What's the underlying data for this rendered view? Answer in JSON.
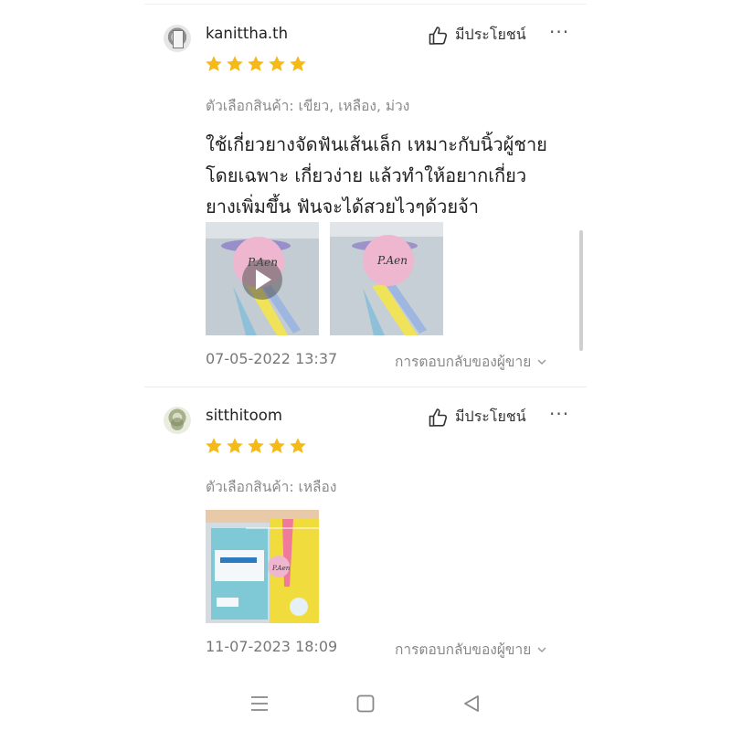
{
  "reviews": [
    {
      "username": "kanittha.th",
      "helpful_label": "มีประโยชน์",
      "stars": 5,
      "variant": "ตัวเลือกสินค้า: เขียว, เหลือง, ม่วง",
      "text_lines": [
        "ใช้เกี่ยวยางจัดฟันเส้นเล็ก เหมาะกับนิ้วผู้ชาย",
        "โดยเฉพาะ  เกี่ยวง่าย แล้วทำให้อยากเกี่ยว",
        "ยางเพิ่มขึ้น ฟันจะได้สวยไวๆด้วยจ้า"
      ],
      "media": [
        {
          "kind": "video",
          "card_text": "P.Aen"
        },
        {
          "kind": "image",
          "card_text": "P.Aen"
        }
      ],
      "date": "07-05-2022 13:37",
      "reply_label": "การตอบกลับของผู้ขาย"
    },
    {
      "username": "sitthitoom",
      "helpful_label": "มีประโยชน์",
      "stars": 5,
      "variant": "ตัวเลือกสินค้า: เหลือง",
      "text_lines": [],
      "media": [
        {
          "kind": "image",
          "card_text": "P.Aen"
        }
      ],
      "date": "11-07-2023 18:09",
      "reply_label": "การตอบกลับของผู้ขาย"
    }
  ],
  "colors": {
    "star": "#f5b918",
    "text": "#1f1f1f",
    "muted": "#888888"
  },
  "icons": {
    "helpful": "thumbs-up-icon",
    "more": "more-icon",
    "reply": "chevron-down-icon",
    "nav": [
      "menu-icon",
      "home-square-icon",
      "back-triangle-icon"
    ]
  }
}
